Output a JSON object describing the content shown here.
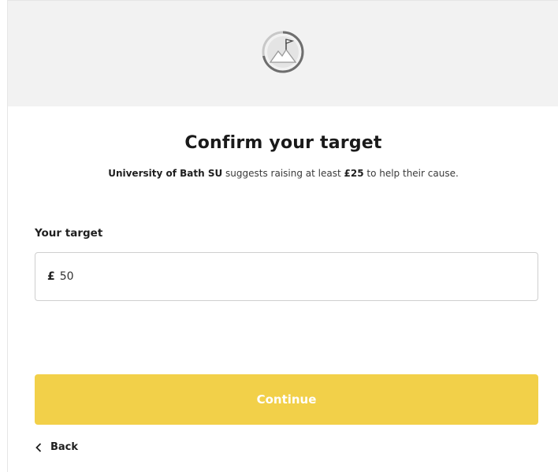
{
  "header": {
    "icon": "mountain-flag-progress-icon"
  },
  "main": {
    "title": "Confirm your target",
    "subtitle": {
      "org": "University of Bath SU",
      "text_1": " suggests raising at least ",
      "amount": "£25",
      "text_2": " to help their cause."
    }
  },
  "form": {
    "label": "Your target",
    "currency_symbol": "£",
    "value": "50"
  },
  "actions": {
    "continue_label": "Continue",
    "back_label": "Back",
    "back_icon": "chevron-left-icon"
  },
  "colors": {
    "accent": "#f2d049",
    "header_band": "#f2f2f2"
  }
}
